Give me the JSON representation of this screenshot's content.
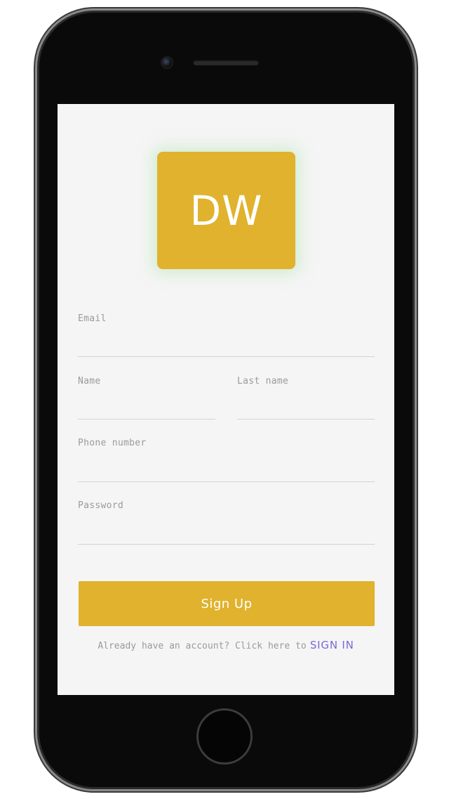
{
  "logo": {
    "text": "DW"
  },
  "form": {
    "email": {
      "label": "Email",
      "value": ""
    },
    "name": {
      "label": "Name",
      "value": ""
    },
    "last_name": {
      "label": "Last name",
      "value": ""
    },
    "phone": {
      "label": "Phone number",
      "value": ""
    },
    "password": {
      "label": "Password",
      "value": ""
    }
  },
  "signup_button": {
    "label": "Sign Up"
  },
  "signin": {
    "prompt": "Already have an account? Click here to",
    "link_label": "SIGN IN"
  },
  "colors": {
    "accent": "#e0b22d",
    "link": "#7b68d8",
    "screen_background": "#f5f5f5"
  }
}
